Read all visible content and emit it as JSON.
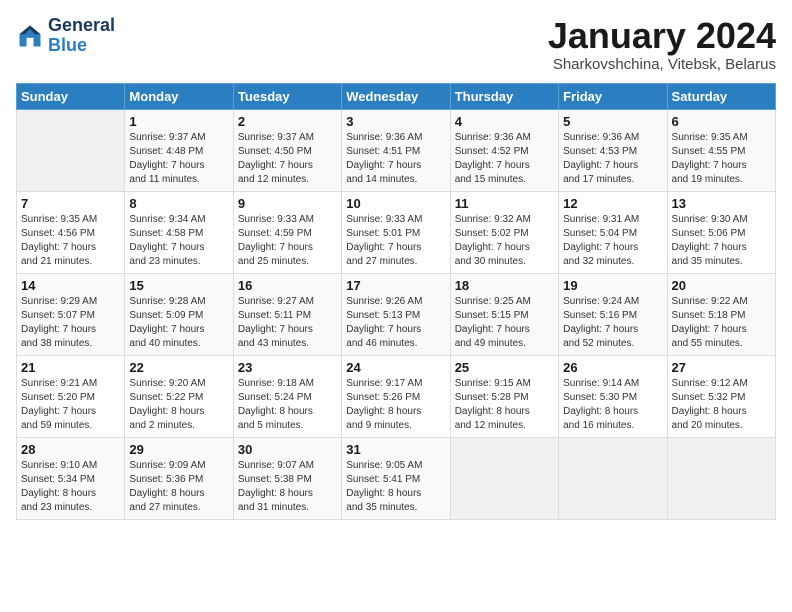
{
  "header": {
    "logo_line1": "General",
    "logo_line2": "Blue",
    "month": "January 2024",
    "location": "Sharkovshchina, Vitebsk, Belarus"
  },
  "days_of_week": [
    "Sunday",
    "Monday",
    "Tuesday",
    "Wednesday",
    "Thursday",
    "Friday",
    "Saturday"
  ],
  "weeks": [
    [
      {
        "day": "",
        "sunrise": "",
        "sunset": "",
        "daylight": ""
      },
      {
        "day": "1",
        "sunrise": "Sunrise: 9:37 AM",
        "sunset": "Sunset: 4:48 PM",
        "daylight": "Daylight: 7 hours and 11 minutes."
      },
      {
        "day": "2",
        "sunrise": "Sunrise: 9:37 AM",
        "sunset": "Sunset: 4:50 PM",
        "daylight": "Daylight: 7 hours and 12 minutes."
      },
      {
        "day": "3",
        "sunrise": "Sunrise: 9:36 AM",
        "sunset": "Sunset: 4:51 PM",
        "daylight": "Daylight: 7 hours and 14 minutes."
      },
      {
        "day": "4",
        "sunrise": "Sunrise: 9:36 AM",
        "sunset": "Sunset: 4:52 PM",
        "daylight": "Daylight: 7 hours and 15 minutes."
      },
      {
        "day": "5",
        "sunrise": "Sunrise: 9:36 AM",
        "sunset": "Sunset: 4:53 PM",
        "daylight": "Daylight: 7 hours and 17 minutes."
      },
      {
        "day": "6",
        "sunrise": "Sunrise: 9:35 AM",
        "sunset": "Sunset: 4:55 PM",
        "daylight": "Daylight: 7 hours and 19 minutes."
      }
    ],
    [
      {
        "day": "7",
        "sunrise": "Sunrise: 9:35 AM",
        "sunset": "Sunset: 4:56 PM",
        "daylight": "Daylight: 7 hours and 21 minutes."
      },
      {
        "day": "8",
        "sunrise": "Sunrise: 9:34 AM",
        "sunset": "Sunset: 4:58 PM",
        "daylight": "Daylight: 7 hours and 23 minutes."
      },
      {
        "day": "9",
        "sunrise": "Sunrise: 9:33 AM",
        "sunset": "Sunset: 4:59 PM",
        "daylight": "Daylight: 7 hours and 25 minutes."
      },
      {
        "day": "10",
        "sunrise": "Sunrise: 9:33 AM",
        "sunset": "Sunset: 5:01 PM",
        "daylight": "Daylight: 7 hours and 27 minutes."
      },
      {
        "day": "11",
        "sunrise": "Sunrise: 9:32 AM",
        "sunset": "Sunset: 5:02 PM",
        "daylight": "Daylight: 7 hours and 30 minutes."
      },
      {
        "day": "12",
        "sunrise": "Sunrise: 9:31 AM",
        "sunset": "Sunset: 5:04 PM",
        "daylight": "Daylight: 7 hours and 32 minutes."
      },
      {
        "day": "13",
        "sunrise": "Sunrise: 9:30 AM",
        "sunset": "Sunset: 5:06 PM",
        "daylight": "Daylight: 7 hours and 35 minutes."
      }
    ],
    [
      {
        "day": "14",
        "sunrise": "Sunrise: 9:29 AM",
        "sunset": "Sunset: 5:07 PM",
        "daylight": "Daylight: 7 hours and 38 minutes."
      },
      {
        "day": "15",
        "sunrise": "Sunrise: 9:28 AM",
        "sunset": "Sunset: 5:09 PM",
        "daylight": "Daylight: 7 hours and 40 minutes."
      },
      {
        "day": "16",
        "sunrise": "Sunrise: 9:27 AM",
        "sunset": "Sunset: 5:11 PM",
        "daylight": "Daylight: 7 hours and 43 minutes."
      },
      {
        "day": "17",
        "sunrise": "Sunrise: 9:26 AM",
        "sunset": "Sunset: 5:13 PM",
        "daylight": "Daylight: 7 hours and 46 minutes."
      },
      {
        "day": "18",
        "sunrise": "Sunrise: 9:25 AM",
        "sunset": "Sunset: 5:15 PM",
        "daylight": "Daylight: 7 hours and 49 minutes."
      },
      {
        "day": "19",
        "sunrise": "Sunrise: 9:24 AM",
        "sunset": "Sunset: 5:16 PM",
        "daylight": "Daylight: 7 hours and 52 minutes."
      },
      {
        "day": "20",
        "sunrise": "Sunrise: 9:22 AM",
        "sunset": "Sunset: 5:18 PM",
        "daylight": "Daylight: 7 hours and 55 minutes."
      }
    ],
    [
      {
        "day": "21",
        "sunrise": "Sunrise: 9:21 AM",
        "sunset": "Sunset: 5:20 PM",
        "daylight": "Daylight: 7 hours and 59 minutes."
      },
      {
        "day": "22",
        "sunrise": "Sunrise: 9:20 AM",
        "sunset": "Sunset: 5:22 PM",
        "daylight": "Daylight: 8 hours and 2 minutes."
      },
      {
        "day": "23",
        "sunrise": "Sunrise: 9:18 AM",
        "sunset": "Sunset: 5:24 PM",
        "daylight": "Daylight: 8 hours and 5 minutes."
      },
      {
        "day": "24",
        "sunrise": "Sunrise: 9:17 AM",
        "sunset": "Sunset: 5:26 PM",
        "daylight": "Daylight: 8 hours and 9 minutes."
      },
      {
        "day": "25",
        "sunrise": "Sunrise: 9:15 AM",
        "sunset": "Sunset: 5:28 PM",
        "daylight": "Daylight: 8 hours and 12 minutes."
      },
      {
        "day": "26",
        "sunrise": "Sunrise: 9:14 AM",
        "sunset": "Sunset: 5:30 PM",
        "daylight": "Daylight: 8 hours and 16 minutes."
      },
      {
        "day": "27",
        "sunrise": "Sunrise: 9:12 AM",
        "sunset": "Sunset: 5:32 PM",
        "daylight": "Daylight: 8 hours and 20 minutes."
      }
    ],
    [
      {
        "day": "28",
        "sunrise": "Sunrise: 9:10 AM",
        "sunset": "Sunset: 5:34 PM",
        "daylight": "Daylight: 8 hours and 23 minutes."
      },
      {
        "day": "29",
        "sunrise": "Sunrise: 9:09 AM",
        "sunset": "Sunset: 5:36 PM",
        "daylight": "Daylight: 8 hours and 27 minutes."
      },
      {
        "day": "30",
        "sunrise": "Sunrise: 9:07 AM",
        "sunset": "Sunset: 5:38 PM",
        "daylight": "Daylight: 8 hours and 31 minutes."
      },
      {
        "day": "31",
        "sunrise": "Sunrise: 9:05 AM",
        "sunset": "Sunset: 5:41 PM",
        "daylight": "Daylight: 8 hours and 35 minutes."
      },
      {
        "day": "",
        "sunrise": "",
        "sunset": "",
        "daylight": ""
      },
      {
        "day": "",
        "sunrise": "",
        "sunset": "",
        "daylight": ""
      },
      {
        "day": "",
        "sunrise": "",
        "sunset": "",
        "daylight": ""
      }
    ]
  ]
}
